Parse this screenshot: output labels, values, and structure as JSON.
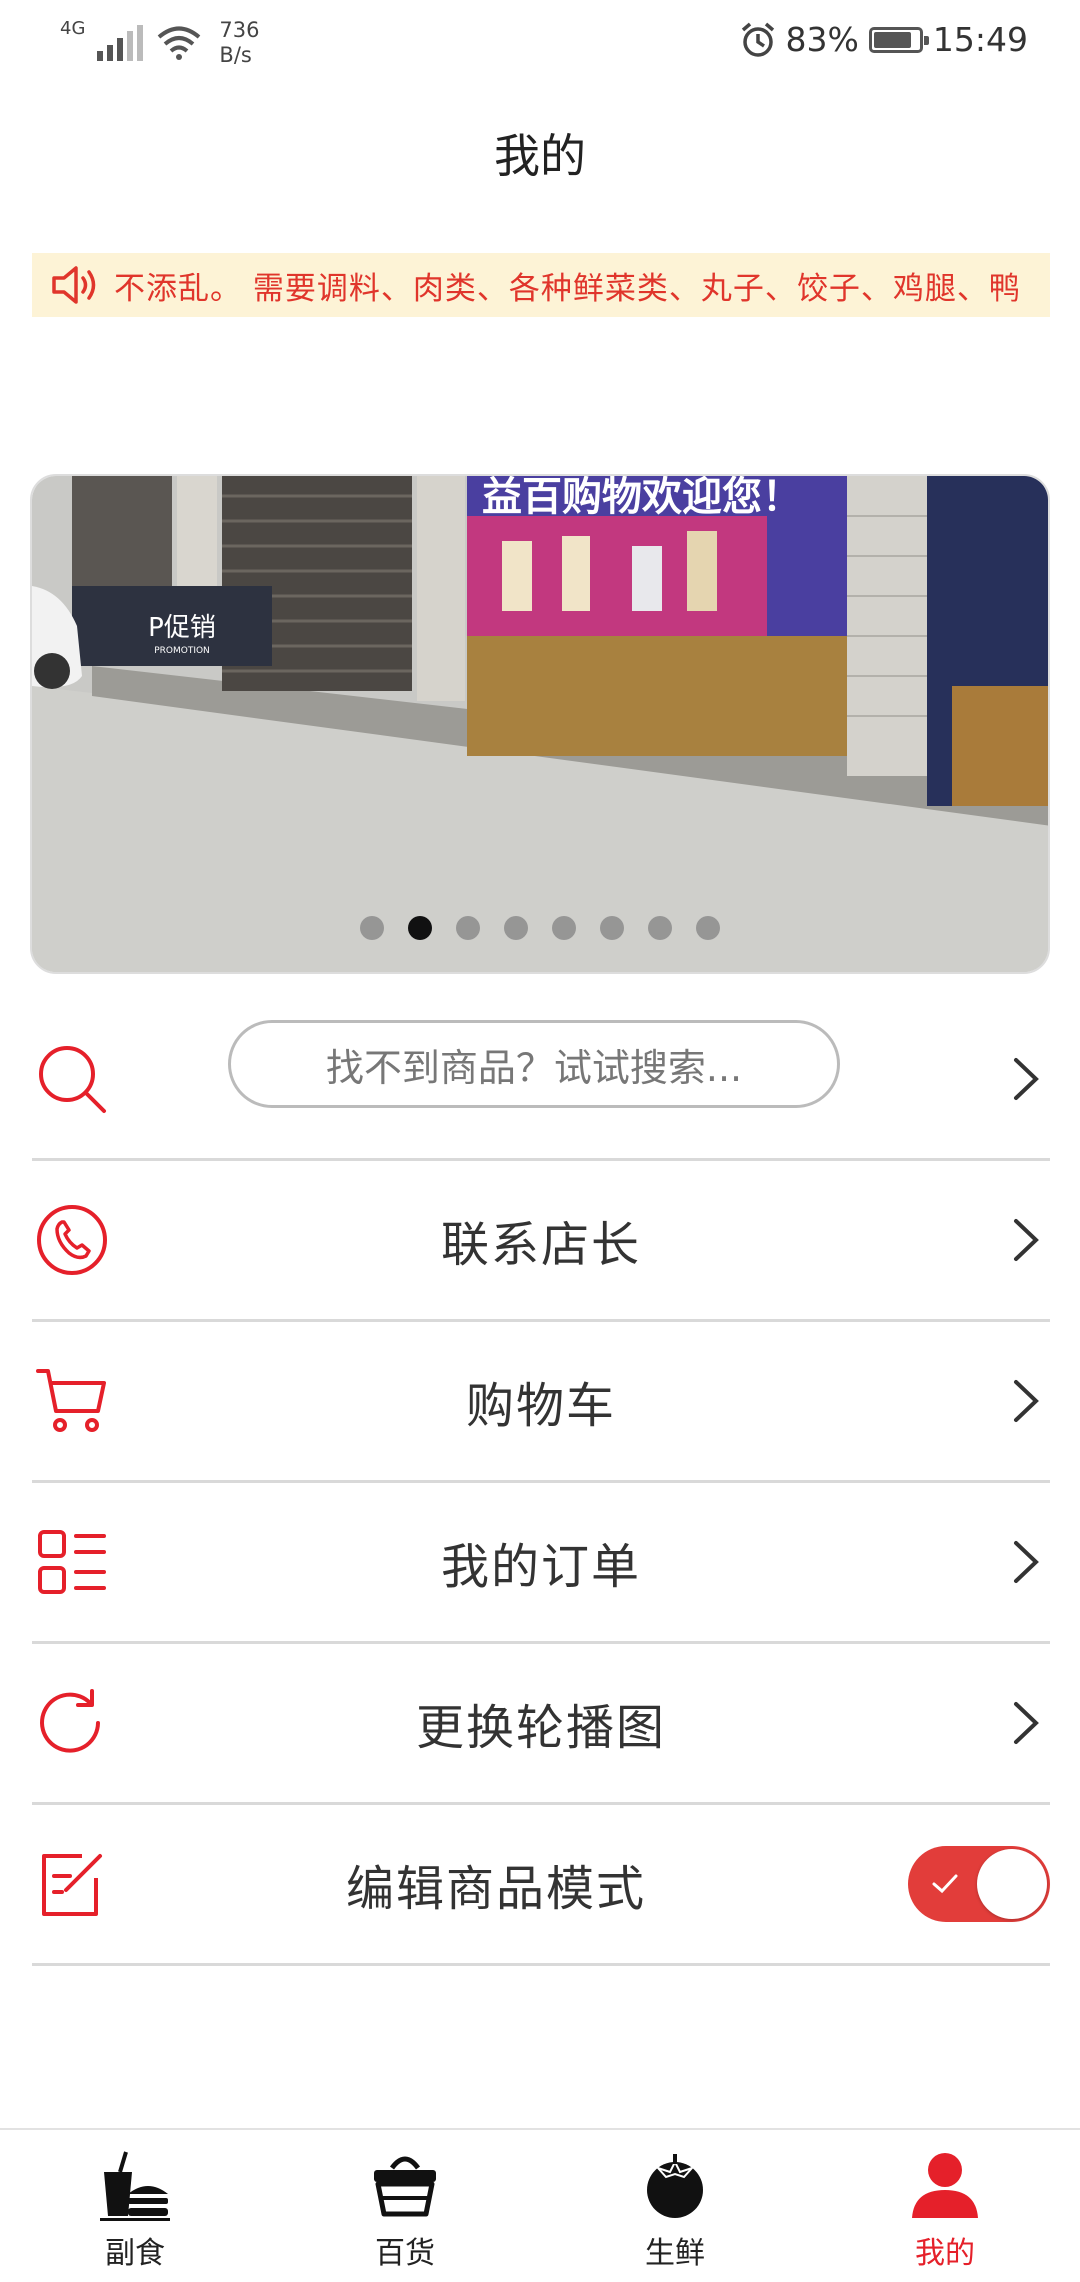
{
  "status_bar": {
    "network": "4G",
    "speed_value": "736",
    "speed_unit": "B/s",
    "battery": "83%",
    "battery_level": 0.83,
    "time": "15:49",
    "icons": [
      "signal-icon",
      "wifi-icon",
      "alarm-icon",
      "battery-icon"
    ]
  },
  "header": {
    "title": "我的"
  },
  "notice": {
    "icon": "speaker-icon",
    "text": "不添乱。 需要调料、肉类、各种鲜菜类、丸子、饺子、鸡腿、鸭"
  },
  "banner": {
    "sign_text": "益百购物欢迎您！",
    "promo_text": "P促销",
    "promo_sub": "PROMOTION",
    "dot_count": 8,
    "active_dot": 1
  },
  "menu": {
    "search_placeholder": "找不到商品？试试搜索...",
    "items": [
      {
        "label": "联系店长",
        "icon": "phone-icon"
      },
      {
        "label": "购物车",
        "icon": "cart-icon"
      },
      {
        "label": "我的订单",
        "icon": "order-list-icon"
      },
      {
        "label": "更换轮播图",
        "icon": "refresh-icon"
      }
    ],
    "edit_mode": {
      "label": "编辑商品模式",
      "icon": "edit-icon",
      "enabled": true
    }
  },
  "tabbar": {
    "tabs": [
      {
        "label": "副食",
        "icon": "drink-burger-icon"
      },
      {
        "label": "百货",
        "icon": "basket-icon"
      },
      {
        "label": "生鲜",
        "icon": "tomato-icon"
      },
      {
        "label": "我的",
        "icon": "user-icon",
        "active": true
      }
    ]
  },
  "colors": {
    "accent": "#e5202a",
    "notice_bg": "#fdf3d6",
    "divider": "#d9d9d9"
  }
}
